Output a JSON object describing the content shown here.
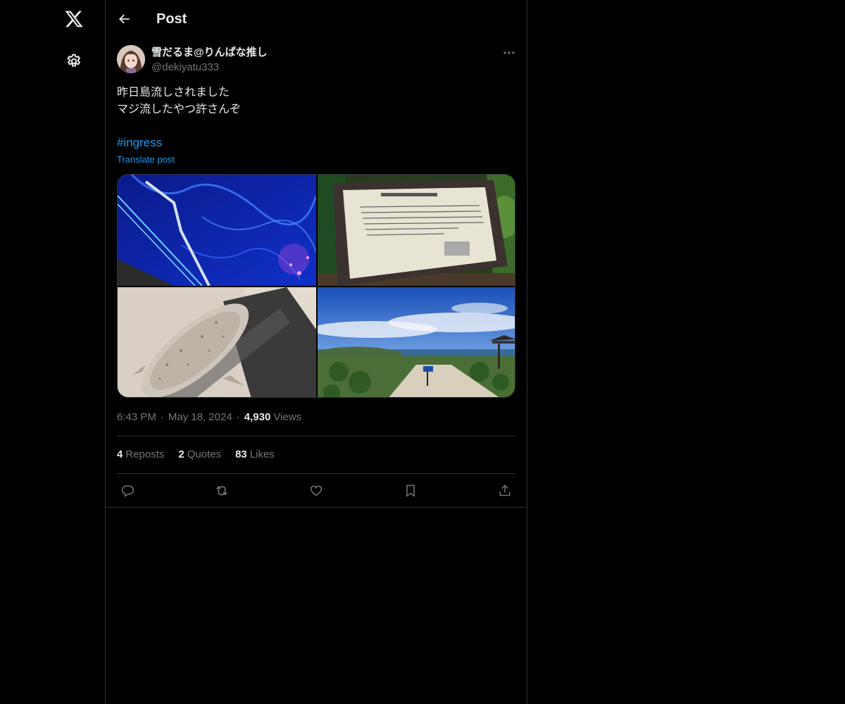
{
  "header": {
    "title": "Post"
  },
  "nav": {
    "logo_icon": "x-logo-icon",
    "settings_icon": "gear-icon"
  },
  "post": {
    "author": {
      "display_name": "雪だるま@りんぱな推し",
      "handle": "@dekiyatu333"
    },
    "text_lines": [
      "昨日島流しされました",
      "マジ流したやつ許さんぞ"
    ],
    "hashtag": "#ingress",
    "translate_label": "Translate post",
    "time": "6:43 PM",
    "date": "May 18, 2024",
    "views_count": "4,930",
    "views_label": "Views",
    "meta_separator": "·",
    "stats": {
      "reposts_count": "4",
      "reposts_label": "Reposts",
      "quotes_count": "2",
      "quotes_label": "Quotes",
      "likes_count": "83",
      "likes_label": "Likes"
    }
  },
  "colors": {
    "background": "#000000",
    "text_primary": "#e7e9ea",
    "text_secondary": "#71767b",
    "accent": "#1d9bf0",
    "border": "#2f3336"
  }
}
